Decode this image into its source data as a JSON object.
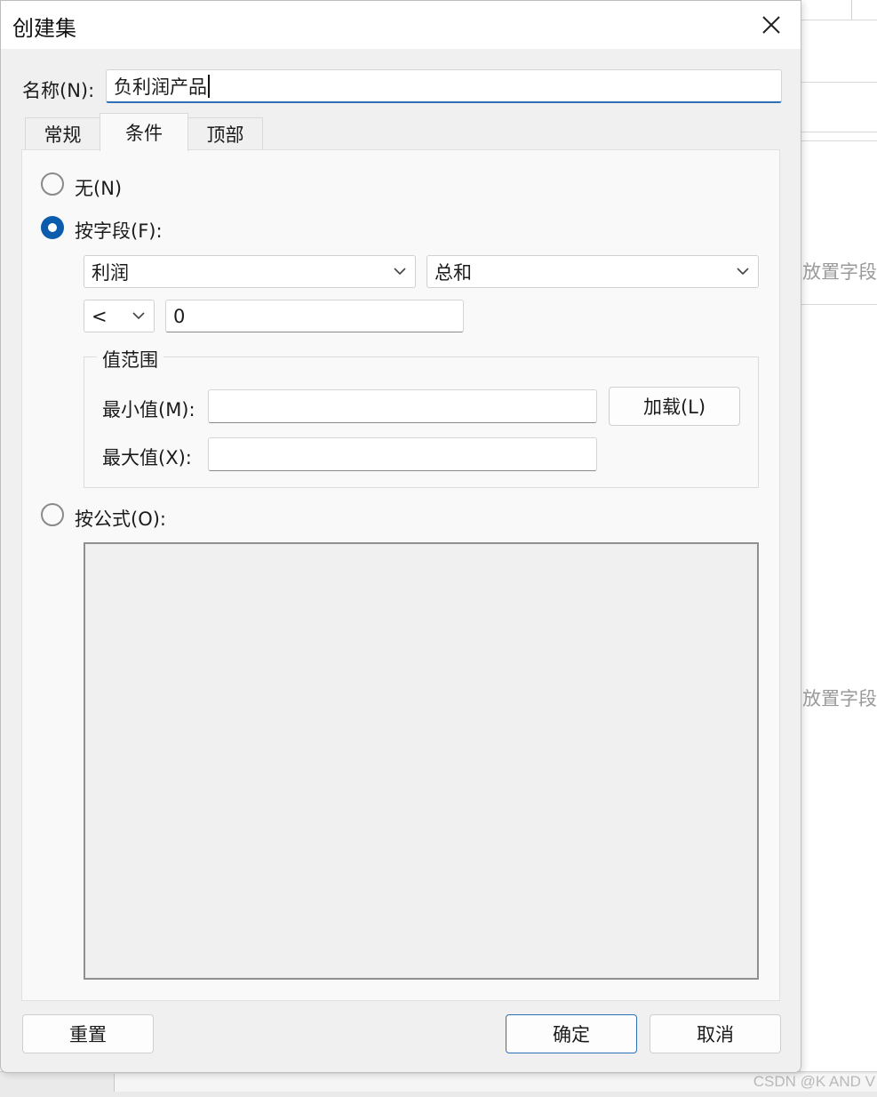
{
  "dialog": {
    "title": "创建集",
    "name_label": "名称(N):",
    "name_value": "负利润产品"
  },
  "tabs": [
    {
      "label": "常规",
      "active": false
    },
    {
      "label": "条件",
      "active": true
    },
    {
      "label": "顶部",
      "active": false
    }
  ],
  "conditions": {
    "none_label": "无(N)",
    "by_field_label": "按字段(F):",
    "selected": "by_field",
    "field_select": "利润",
    "aggregation_select": "总和",
    "operator_select": "<",
    "value": "0",
    "range": {
      "group_title": "值范围",
      "min_label": "最小值(M):",
      "min_value": "",
      "max_label": "最大值(X):",
      "max_value": "",
      "load_button": "加载(L)"
    },
    "by_formula_label": "按公式(O):",
    "formula_value": ""
  },
  "footer": {
    "reset_button": "重置",
    "ok_button": "确定",
    "cancel_button": "取消"
  },
  "background": {
    "hint_text_1": "放置字段",
    "hint_text_2": "放置字段",
    "watermark": "CSDN @K AND V"
  },
  "colors": {
    "accent": "#0b5cad",
    "input_focus_border": "#2f6fb5"
  }
}
